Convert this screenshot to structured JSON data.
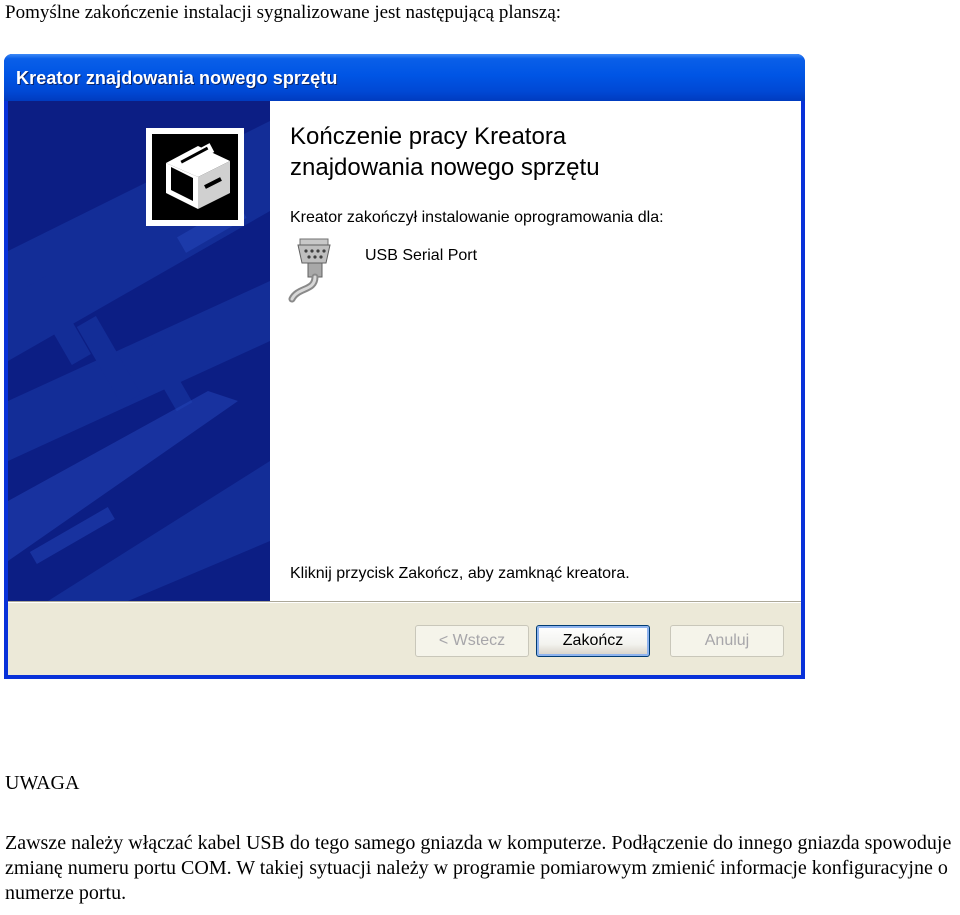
{
  "intro_text": "Pomyślne zakończenie instalacji sygnalizowane jest następującą planszą:",
  "dialog": {
    "title": "Kreator znajdowania nowego sprzętu",
    "heading_line1": "Kończenie pracy Kreatora",
    "heading_line2": "znajdowania nowego sprzętu",
    "status_text": "Kreator zakończył instalowanie oprogramowania dla:",
    "device_name": "USB Serial Port",
    "device_icon": "serial-port-connector-icon",
    "banner_icon": "hardware-wizard-icon",
    "finish_hint": "Kliknij przycisk Zakończ, aby zamknąć kreatora.",
    "buttons": {
      "back": "< Wstecz",
      "finish": "Zakończ",
      "cancel": "Anuluj"
    },
    "colors": {
      "titlebar": "#0055e5",
      "banner": "#0c1e84",
      "client": "#ece9d8"
    }
  },
  "warning": {
    "title": "UWAGA",
    "text": "Zawsze należy włączać kabel USB do tego samego gniazda w komputerze. Podłączenie do innego gniazda spowoduje zmianę numeru portu COM. W takiej sytuacji należy w programie pomiarowym zmienić informacje konfiguracyjne o numerze portu."
  }
}
